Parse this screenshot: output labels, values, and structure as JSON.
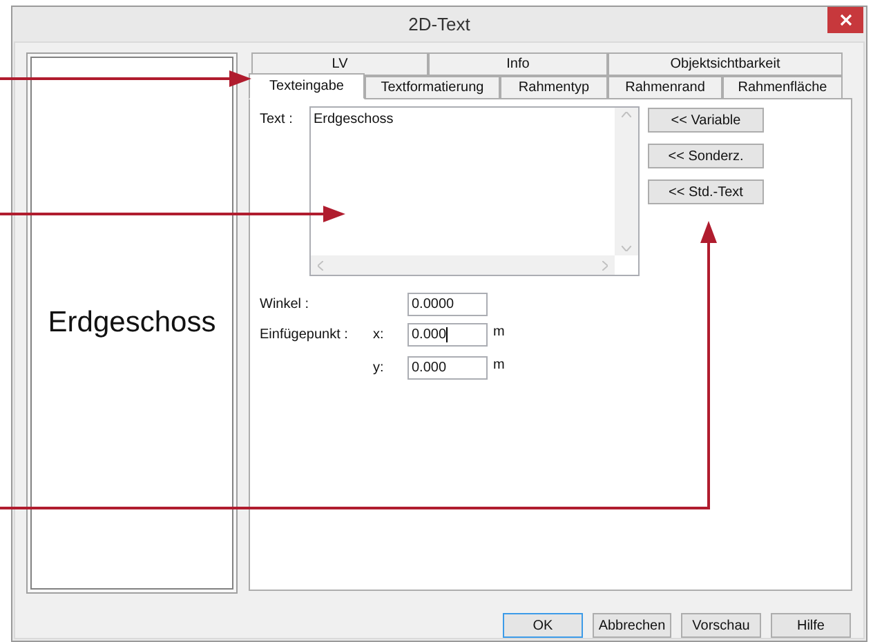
{
  "window": {
    "title": "2D-Text"
  },
  "preview": {
    "text": "Erdgeschoss"
  },
  "tab_rows": [
    [
      {
        "label": "LV",
        "selected": false
      },
      {
        "label": "Info",
        "selected": false
      },
      {
        "label": "Objektsichtbarkeit",
        "selected": false
      }
    ],
    [
      {
        "label": "Texteingabe",
        "selected": true
      },
      {
        "label": "Textformatierung",
        "selected": false
      },
      {
        "label": "Rahmentyp",
        "selected": false
      },
      {
        "label": "Rahmenrand",
        "selected": false
      },
      {
        "label": "Rahmenfläche",
        "selected": false
      }
    ]
  ],
  "text_field": {
    "label": "Text :",
    "value": "Erdgeschoss"
  },
  "side_buttons": [
    "<< Variable",
    "<< Sonderz.",
    "<< Std.-Text"
  ],
  "angle": {
    "label": "Winkel :",
    "value": "0.0000"
  },
  "insertion_point": {
    "label": "Einfügepunkt :",
    "x_label": "x:",
    "x_value": "0.000",
    "x_unit": "m",
    "y_label": "y:",
    "y_value": "0.000",
    "y_unit": "m"
  },
  "buttons": [
    {
      "label": "OK",
      "default": true
    },
    {
      "label": "Abbrechen",
      "default": false
    },
    {
      "label": "Vorschau",
      "default": false
    },
    {
      "label": "Hilfe",
      "default": false
    }
  ]
}
